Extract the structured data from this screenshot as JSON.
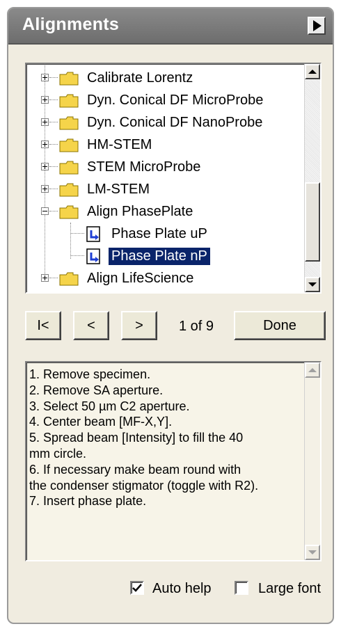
{
  "window": {
    "title": "Alignments",
    "collapse_icon": "play-arrow-icon"
  },
  "tree": {
    "items": [
      {
        "label": "Calibrate Lorentz",
        "type": "folder",
        "expander": "+"
      },
      {
        "label": "Dyn. Conical DF MicroProbe",
        "type": "folder",
        "expander": "+"
      },
      {
        "label": "Dyn. Conical DF NanoProbe",
        "type": "folder",
        "expander": "+"
      },
      {
        "label": "HM-STEM",
        "type": "folder",
        "expander": "+"
      },
      {
        "label": "STEM MicroProbe",
        "type": "folder",
        "expander": "+"
      },
      {
        "label": "LM-STEM",
        "type": "folder",
        "expander": "+"
      },
      {
        "label": "Align PhasePlate",
        "type": "folder",
        "expander": "-"
      },
      {
        "label": "Phase Plate uP",
        "type": "procedure"
      },
      {
        "label": "Phase Plate nP",
        "type": "procedure",
        "selected": true
      },
      {
        "label": "Align LifeScience",
        "type": "folder",
        "expander": "+"
      }
    ]
  },
  "nav": {
    "first_label": "I<",
    "prev_label": "<",
    "next_label": ">",
    "page": "1 of 9",
    "done_label": "Done"
  },
  "help": {
    "lines": [
      "1. Remove specimen.",
      "2. Remove SA aperture.",
      "3. Select 50 µm C2 aperture.",
      "4. Center beam [MF-X,Y].",
      "5. Spread beam [Intensity] to fill the 40",
      "mm circle.",
      "6. If necessary make beam round with",
      "the condenser stigmator (toggle with R2).",
      "7. Insert phase plate."
    ]
  },
  "options": {
    "auto_help": {
      "label": "Auto help",
      "checked": true
    },
    "large_font": {
      "label": "Large font",
      "checked": false
    }
  },
  "colors": {
    "selection": "#0a246a",
    "folder": "#f5d44a",
    "titlebar": "#7a7a7a",
    "panel": "#f0ece0"
  }
}
